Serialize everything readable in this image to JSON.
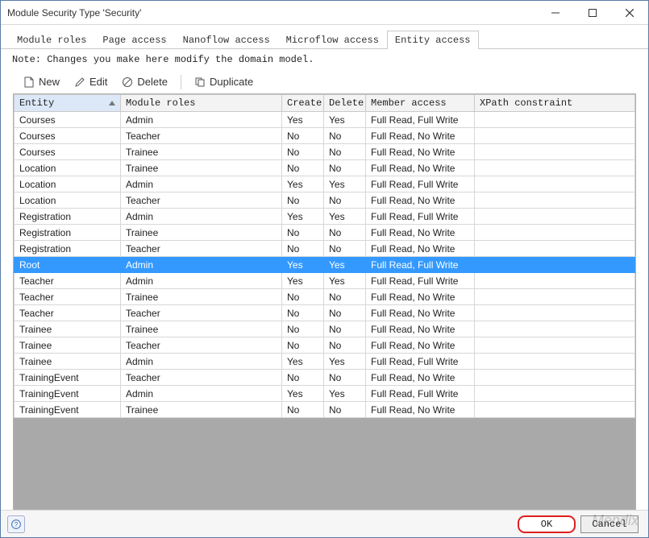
{
  "window": {
    "title": "Module Security Type 'Security'"
  },
  "tabs": [
    {
      "label": "Module roles",
      "active": false
    },
    {
      "label": "Page access",
      "active": false
    },
    {
      "label": "Nanoflow access",
      "active": false
    },
    {
      "label": "Microflow access",
      "active": false
    },
    {
      "label": "Entity access",
      "active": true
    }
  ],
  "note": "Note: Changes you make here modify the domain model.",
  "toolbar": {
    "new": "New",
    "edit": "Edit",
    "delete": "Delete",
    "duplicate": "Duplicate"
  },
  "columns": {
    "entity": "Entity",
    "roles": "Module roles",
    "create": "Create",
    "delete": "Delete",
    "member": "Member access",
    "xpath": "XPath constraint"
  },
  "rows": [
    {
      "entity": "Courses",
      "roles": "Admin",
      "create": "Yes",
      "delete": "Yes",
      "member": "Full Read, Full Write",
      "xpath": "",
      "selected": false
    },
    {
      "entity": "Courses",
      "roles": "Teacher",
      "create": "No",
      "delete": "No",
      "member": "Full Read, No Write",
      "xpath": "",
      "selected": false
    },
    {
      "entity": "Courses",
      "roles": "Trainee",
      "create": "No",
      "delete": "No",
      "member": "Full Read, No Write",
      "xpath": "",
      "selected": false
    },
    {
      "entity": "Location",
      "roles": "Trainee",
      "create": "No",
      "delete": "No",
      "member": "Full Read, No Write",
      "xpath": "",
      "selected": false
    },
    {
      "entity": "Location",
      "roles": "Admin",
      "create": "Yes",
      "delete": "Yes",
      "member": "Full Read, Full Write",
      "xpath": "",
      "selected": false
    },
    {
      "entity": "Location",
      "roles": "Teacher",
      "create": "No",
      "delete": "No",
      "member": "Full Read, No Write",
      "xpath": "",
      "selected": false
    },
    {
      "entity": "Registration",
      "roles": "Admin",
      "create": "Yes",
      "delete": "Yes",
      "member": "Full Read, Full Write",
      "xpath": "",
      "selected": false
    },
    {
      "entity": "Registration",
      "roles": "Trainee",
      "create": "No",
      "delete": "No",
      "member": "Full Read, No Write",
      "xpath": "",
      "selected": false
    },
    {
      "entity": "Registration",
      "roles": "Teacher",
      "create": "No",
      "delete": "No",
      "member": "Full Read, No Write",
      "xpath": "",
      "selected": false
    },
    {
      "entity": "Root",
      "roles": "Admin",
      "create": "Yes",
      "delete": "Yes",
      "member": "Full Read, Full Write",
      "xpath": "",
      "selected": true
    },
    {
      "entity": "Teacher",
      "roles": "Admin",
      "create": "Yes",
      "delete": "Yes",
      "member": "Full Read, Full Write",
      "xpath": "",
      "selected": false
    },
    {
      "entity": "Teacher",
      "roles": "Trainee",
      "create": "No",
      "delete": "No",
      "member": "Full Read, No Write",
      "xpath": "",
      "selected": false
    },
    {
      "entity": "Teacher",
      "roles": "Teacher",
      "create": "No",
      "delete": "No",
      "member": "Full Read, No Write",
      "xpath": "",
      "selected": false
    },
    {
      "entity": "Trainee",
      "roles": "Trainee",
      "create": "No",
      "delete": "No",
      "member": "Full Read, No Write",
      "xpath": "",
      "selected": false
    },
    {
      "entity": "Trainee",
      "roles": "Teacher",
      "create": "No",
      "delete": "No",
      "member": "Full Read, No Write",
      "xpath": "",
      "selected": false
    },
    {
      "entity": "Trainee",
      "roles": "Admin",
      "create": "Yes",
      "delete": "Yes",
      "member": "Full Read, Full Write",
      "xpath": "",
      "selected": false
    },
    {
      "entity": "TrainingEvent",
      "roles": "Teacher",
      "create": "No",
      "delete": "No",
      "member": "Full Read, No Write",
      "xpath": "",
      "selected": false
    },
    {
      "entity": "TrainingEvent",
      "roles": "Admin",
      "create": "Yes",
      "delete": "Yes",
      "member": "Full Read, Full Write",
      "xpath": "",
      "selected": false
    },
    {
      "entity": "TrainingEvent",
      "roles": "Trainee",
      "create": "No",
      "delete": "No",
      "member": "Full Read, No Write",
      "xpath": "",
      "selected": false
    }
  ],
  "footer": {
    "ok": "OK",
    "cancel": "Cancel"
  },
  "watermark": "Mendix"
}
